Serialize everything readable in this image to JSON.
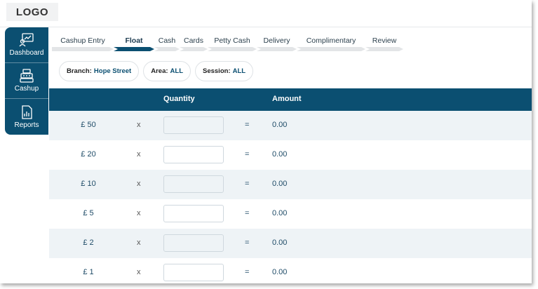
{
  "logo": {
    "text": "LOGO"
  },
  "sidebar": {
    "items": [
      {
        "label": "Dashboard",
        "icon": "dashboard-icon"
      },
      {
        "label": "Cashup",
        "icon": "cash-register-icon"
      },
      {
        "label": "Reports",
        "icon": "report-icon"
      }
    ]
  },
  "steps": [
    {
      "label": "Cashup Entry",
      "active": false
    },
    {
      "label": "Float",
      "active": true
    },
    {
      "label": "Cash",
      "active": false
    },
    {
      "label": "Cards",
      "active": false
    },
    {
      "label": "Petty Cash",
      "active": false
    },
    {
      "label": "Delivery",
      "active": false
    },
    {
      "label": "Complimentary",
      "active": false
    },
    {
      "label": "Review",
      "active": false
    }
  ],
  "filters": {
    "branch": {
      "label": "Branch:",
      "value": "Hope Street"
    },
    "area": {
      "label": "Area:",
      "value": "ALL"
    },
    "session": {
      "label": "Session:",
      "value": "ALL"
    }
  },
  "table": {
    "headers": {
      "quantity": "Quantity",
      "amount": "Amount"
    },
    "rows": [
      {
        "denomination": "£ 50",
        "times": "x",
        "quantity": "",
        "equals": "=",
        "amount": "0.00"
      },
      {
        "denomination": "£ 20",
        "times": "x",
        "quantity": "",
        "equals": "=",
        "amount": "0.00"
      },
      {
        "denomination": "£ 10",
        "times": "x",
        "quantity": "",
        "equals": "=",
        "amount": "0.00"
      },
      {
        "denomination": "£ 5",
        "times": "x",
        "quantity": "",
        "equals": "=",
        "amount": "0.00"
      },
      {
        "denomination": "£ 2",
        "times": "x",
        "quantity": "",
        "equals": "=",
        "amount": "0.00"
      },
      {
        "denomination": "£ 1",
        "times": "x",
        "quantity": "",
        "equals": "=",
        "amount": "0.00"
      }
    ]
  },
  "colors": {
    "brand": "#0b4f71",
    "row_alt": "#eef3f6",
    "step_inactive": "#e3e5e7"
  }
}
